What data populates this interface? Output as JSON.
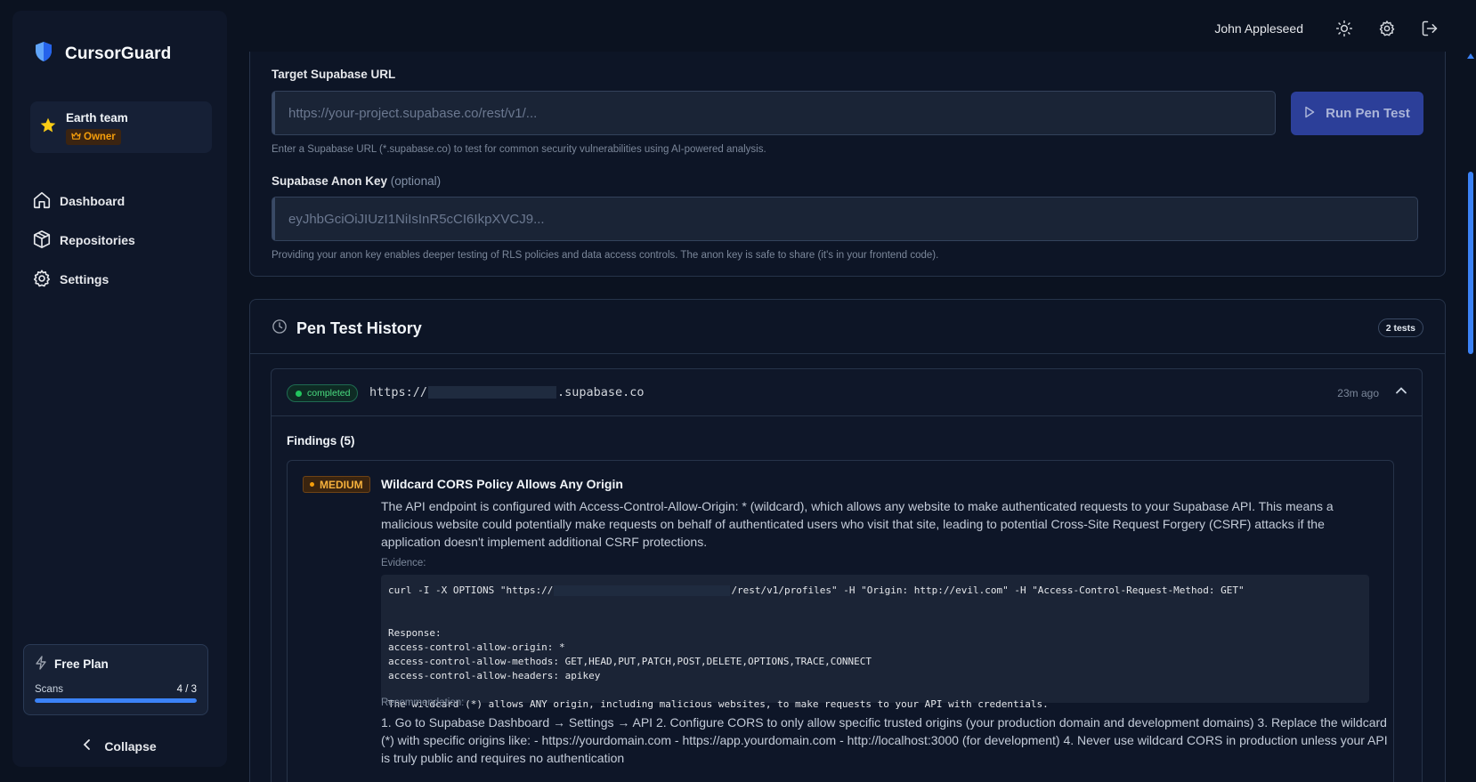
{
  "brand": {
    "name": "CursorGuard"
  },
  "team": {
    "name": "Earth team",
    "role": "Owner"
  },
  "nav": [
    {
      "label": "Dashboard",
      "icon": "home-icon"
    },
    {
      "label": "Repositories",
      "icon": "box-icon"
    },
    {
      "label": "Settings",
      "icon": "gear-icon"
    }
  ],
  "plan": {
    "name": "Free Plan",
    "scans_label": "Scans",
    "scans_count": "4 / 3",
    "scans_fraction": 1.0
  },
  "collapse_label": "Collapse",
  "header": {
    "user_name": "John Appleseed"
  },
  "form": {
    "url_label": "Target Supabase URL",
    "url_placeholder": "https://your-project.supabase.co/rest/v1/...",
    "url_hint": "Enter a Supabase URL (*.supabase.co) to test for common security vulnerabilities using AI-powered analysis.",
    "run_label": "Run Pen Test",
    "key_label": "Supabase Anon Key",
    "key_optional": "(optional)",
    "key_placeholder": "eyJhbGciOiJIUzI1NiIsInR5cCI6IkpXVCJ9...",
    "key_hint": "Providing your anon key enables deeper testing of RLS policies and data access controls. The anon key is safe to share (it's in your frontend code)."
  },
  "history": {
    "title": "Pen Test History",
    "count_badge": "2 tests",
    "tests": [
      {
        "status": "completed",
        "url_prefix": "https://",
        "url_suffix": ".supabase.co",
        "time_ago": "23m ago",
        "findings_title": "Findings (5)",
        "findings": [
          {
            "severity": "MEDIUM",
            "title": "Wildcard CORS Policy Allows Any Origin",
            "description": "The API endpoint is configured with Access-Control-Allow-Origin: * (wildcard), which allows any website to make authenticated requests to your Supabase API. This means a malicious website could potentially make requests on behalf of authenticated users who visit that site, leading to potential Cross-Site Request Forgery (CSRF) attacks if the application doesn't implement additional CSRF protections.",
            "evidence_label": "Evidence:",
            "evidence_cmd_prefix": "curl -I -X OPTIONS \"https://",
            "evidence_cmd_suffix": "/rest/v1/profiles\" -H \"Origin: http://evil.com\" -H \"Access-Control-Request-Method: GET\"",
            "evidence_body": "Response:\naccess-control-allow-origin: *\naccess-control-allow-methods: GET,HEAD,PUT,PATCH,POST,DELETE,OPTIONS,TRACE,CONNECT\naccess-control-allow-headers: apikey\n\nThe wildcard (*) allows ANY origin, including malicious websites, to make requests to your API with credentials.",
            "recommendation_label": "Recommendation:",
            "recommendation": "1. Go to Supabase Dashboard → Settings → API 2. Configure CORS to only allow specific trusted origins (your production domain and development domains) 3. Replace the wildcard (*) with specific origins like: - https://yourdomain.com - https://app.yourdomain.com - http://localhost:3000 (for development) 4. Never use wildcard CORS in production unless your API is truly public and requires no authentication"
          }
        ]
      }
    ]
  },
  "colors": {
    "accent": "#3b82f6",
    "background": "#0b1220",
    "medium": "#f59e0b",
    "success": "#22c55e"
  }
}
